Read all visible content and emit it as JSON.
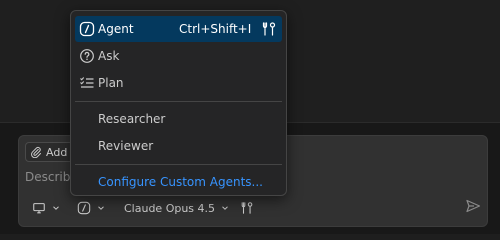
{
  "chat": {
    "add_context_label": "Add",
    "placeholder": "Describe"
  },
  "toolbar": {
    "model_label": "Claude Opus 4.5"
  },
  "menu": {
    "items": [
      {
        "label": "Agent",
        "shortcut": "Ctrl+Shift+I",
        "icon": "agent-icon",
        "active": true
      },
      {
        "label": "Ask",
        "icon": "question-icon"
      },
      {
        "label": "Plan",
        "icon": "checklist-icon"
      }
    ],
    "custom_agents": [
      {
        "label": "Researcher"
      },
      {
        "label": "Reviewer"
      }
    ],
    "configure_label": "Configure Custom Agents..."
  },
  "colors": {
    "accent": "#04395e",
    "link": "#3794ff",
    "menu_bg": "#252526"
  }
}
